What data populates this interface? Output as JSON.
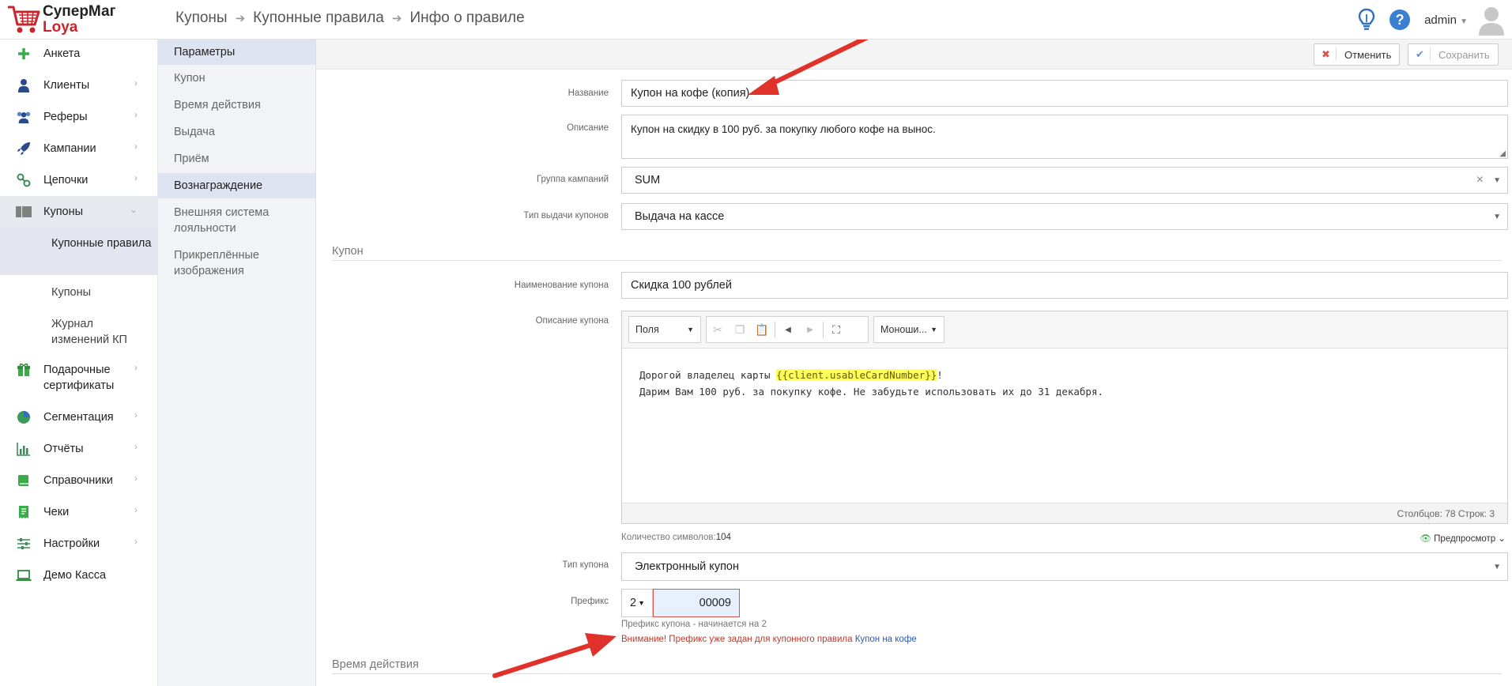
{
  "app": {
    "brand_line1": "СуперМаг",
    "brand_line2": "Loya",
    "user": "admin"
  },
  "breadcrumb": [
    "Купоны",
    "Купонные правила",
    "Инфо о правиле"
  ],
  "nav": [
    {
      "label": "Анкета",
      "icon": "plus-icon"
    },
    {
      "label": "Клиенты",
      "icon": "user-icon"
    },
    {
      "label": "Реферы",
      "icon": "users-icon"
    },
    {
      "label": "Кампании",
      "icon": "rocket-icon"
    },
    {
      "label": "Цепочки",
      "icon": "chain-icon"
    },
    {
      "label": "Купоны",
      "icon": "barcode-icon"
    },
    {
      "label": "Подарочные сертификаты",
      "icon": "gift-icon"
    },
    {
      "label": "Сегментация",
      "icon": "pie-icon"
    },
    {
      "label": "Отчёты",
      "icon": "bar-chart-icon"
    },
    {
      "label": "Справочники",
      "icon": "book-icon"
    },
    {
      "label": "Чеки",
      "icon": "receipt-icon"
    },
    {
      "label": "Настройки",
      "icon": "sliders-icon"
    },
    {
      "label": "Демо Касса",
      "icon": "laptop-icon"
    }
  ],
  "coupon_sub": [
    "Купонные правила",
    "Купоны",
    "Журнал изменений КП"
  ],
  "tabs": [
    "Параметры",
    "Купон",
    "Время действия",
    "Выдача",
    "Приём",
    "Вознаграждение",
    "Внешняя система лояльности",
    "Прикреплённые изображения"
  ],
  "toolbar": {
    "cancel": "Отменить",
    "save": "Сохранить"
  },
  "form": {
    "name_label": "Название",
    "name_value": "Купон на кофе (копия)",
    "desc_label": "Описание",
    "desc_value": "Купон на скидку в 100 руб. за покупку любого кофе на вынос.",
    "group_label": "Группа кампаний",
    "group_value": "SUM",
    "issue_type_label": "Тип выдачи купонов",
    "issue_type_value": "Выдача на кассе",
    "section_coupon": "Купон",
    "coupon_name_label": "Наименование купона",
    "coupon_name_value": "Скидка 100 рублей",
    "coupon_desc_label": "Описание купона",
    "editor": {
      "fields_select": "Поля",
      "font_select": "Моноши...",
      "line1_pre": "Дорогой владелец карты ",
      "line1_var": "{{client.usableCardNumber}}",
      "line1_post": "!",
      "line2": "Дарим Вам 100 руб. за покупку кофе. Не забудьте использовать их до 31 декабря.",
      "status": "Столбцов: 78 Строк: 3"
    },
    "char_count_label": "Количество символов:",
    "char_count": "104",
    "preview": "Предпросмотр",
    "coupon_type_label": "Тип купона",
    "coupon_type_value": "Электронный купон",
    "prefix_label": "Префикс",
    "prefix_select": "2",
    "prefix_value": "00009",
    "prefix_hint": "Префикс купона - начинается на 2",
    "warning_text": "Внимание! Префикс уже задан для купонного правила ",
    "warning_link": "Купон на кофе",
    "section_time": "Время действия"
  }
}
